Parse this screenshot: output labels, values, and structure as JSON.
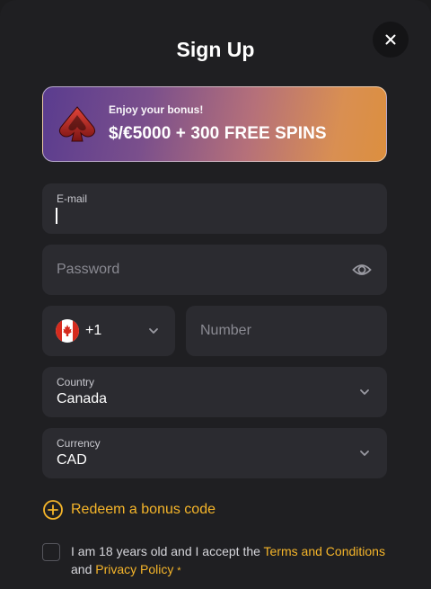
{
  "title": "Sign Up",
  "banner": {
    "subtitle": "Enjoy your bonus!",
    "headline": "$/€5000 + 300 FREE SPINS"
  },
  "email": {
    "label": "E-mail",
    "value": ""
  },
  "password": {
    "placeholder": "Password"
  },
  "phone": {
    "country_code": "+1",
    "placeholder": "Number"
  },
  "country": {
    "label": "Country",
    "value": "Canada"
  },
  "currency": {
    "label": "Currency",
    "value": "CAD"
  },
  "redeem": {
    "label": "Redeem a bonus code"
  },
  "consent": {
    "text_before": "I am 18 years old and I accept the ",
    "terms_link": "Terms and Conditions",
    "text_and": "and ",
    "privacy_link": "Privacy Policy",
    "required_mark": "*"
  },
  "colors": {
    "accent": "#f5b52a",
    "field_bg": "#2b2b30",
    "modal_bg": "#1f1f22"
  },
  "icons": {
    "close": "close-icon",
    "eye": "eye-icon",
    "flag": "canada-flag-icon",
    "plus": "plus-circle-icon",
    "chevron": "chevron-down-icon",
    "logo": "spade-logo-icon"
  }
}
